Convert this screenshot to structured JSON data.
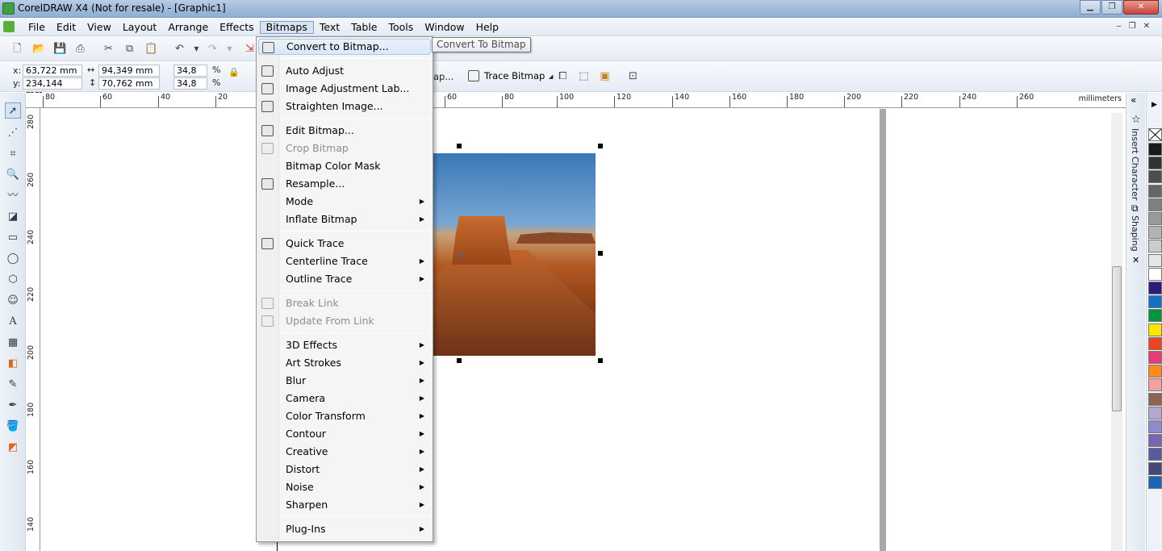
{
  "window": {
    "title": "CorelDRAW X4 (Not for resale) - [Graphic1]"
  },
  "menubar": {
    "items": [
      "File",
      "Edit",
      "View",
      "Layout",
      "Arrange",
      "Effects",
      "Bitmaps",
      "Text",
      "Table",
      "Tools",
      "Window",
      "Help"
    ],
    "active": "Bitmaps"
  },
  "property_bar": {
    "x_label": "x:",
    "x_value": "63,722 mm",
    "y_label": "y:",
    "y_value": "234,144 mm",
    "width_value": "94,349 mm",
    "height_value": "70,762 mm",
    "scale_x": "34,8",
    "scale_y": "34,8",
    "percent": "%",
    "edit_bitmap_partial": "ap...",
    "trace_bitmap_label": "Trace Bitmap"
  },
  "ruler": {
    "units": "millimeters",
    "top_ticks": [
      "80",
      "60",
      "40",
      "20",
      "60",
      "80",
      "100",
      "120",
      "140",
      "160",
      "180",
      "200",
      "220",
      "240",
      "260"
    ],
    "left_ticks": [
      "280",
      "260",
      "240",
      "220",
      "200",
      "180",
      "160",
      "140"
    ]
  },
  "dockers": {
    "insert_character": "Insert Character",
    "shaping": "Shaping"
  },
  "tooltip": "Convert To Bitmap",
  "bitmaps_menu": {
    "items": [
      {
        "label": "Convert to Bitmap...",
        "disabled": false,
        "submenu": false
      },
      {
        "label": "Auto Adjust",
        "disabled": false,
        "submenu": false
      },
      {
        "label": "Image Adjustment Lab...",
        "disabled": false,
        "submenu": false
      },
      {
        "label": "Straighten Image...",
        "disabled": false,
        "submenu": false
      },
      {
        "label": "Edit Bitmap...",
        "disabled": false,
        "submenu": false
      },
      {
        "label": "Crop Bitmap",
        "disabled": true,
        "submenu": false
      },
      {
        "label": "Bitmap Color Mask",
        "disabled": false,
        "submenu": false
      },
      {
        "label": "Resample...",
        "disabled": false,
        "submenu": false
      },
      {
        "label": "Mode",
        "disabled": false,
        "submenu": true
      },
      {
        "label": "Inflate Bitmap",
        "disabled": false,
        "submenu": true
      },
      {
        "label": "Quick Trace",
        "disabled": false,
        "submenu": false
      },
      {
        "label": "Centerline Trace",
        "disabled": false,
        "submenu": true
      },
      {
        "label": "Outline Trace",
        "disabled": false,
        "submenu": true
      },
      {
        "label": "Break Link",
        "disabled": true,
        "submenu": false
      },
      {
        "label": "Update From Link",
        "disabled": true,
        "submenu": false
      },
      {
        "label": "3D Effects",
        "disabled": false,
        "submenu": true
      },
      {
        "label": "Art Strokes",
        "disabled": false,
        "submenu": true
      },
      {
        "label": "Blur",
        "disabled": false,
        "submenu": true
      },
      {
        "label": "Camera",
        "disabled": false,
        "submenu": true
      },
      {
        "label": "Color Transform",
        "disabled": false,
        "submenu": true
      },
      {
        "label": "Contour",
        "disabled": false,
        "submenu": true
      },
      {
        "label": "Creative",
        "disabled": false,
        "submenu": true
      },
      {
        "label": "Distort",
        "disabled": false,
        "submenu": true
      },
      {
        "label": "Noise",
        "disabled": false,
        "submenu": true
      },
      {
        "label": "Sharpen",
        "disabled": false,
        "submenu": true
      },
      {
        "label": "Plug-Ins",
        "disabled": false,
        "submenu": true
      }
    ]
  },
  "palette_colors": [
    "#1a1a1a",
    "#333333",
    "#4d4d4d",
    "#666666",
    "#808080",
    "#999999",
    "#b3b3b3",
    "#cccccc",
    "#e6e6e6",
    "#ffffff",
    "#2e1a78",
    "#1570c8",
    "#00963f",
    "#ffe600",
    "#e8461e",
    "#e63c78",
    "#ff8c1a",
    "#f5a0a0",
    "#8c6450",
    "#b4a8d2",
    "#8c8cc8",
    "#7a64b4",
    "#5a5aa0",
    "#464678",
    "#1e64b4"
  ],
  "accent": "#d6e3f3"
}
